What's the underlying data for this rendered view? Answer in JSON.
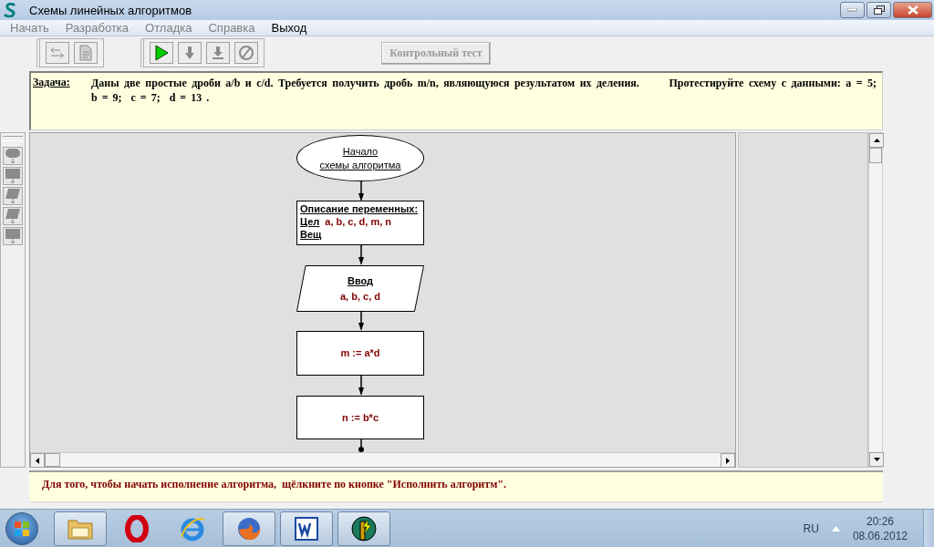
{
  "window": {
    "title": "Схемы линейных алгоритмов"
  },
  "menu": [
    {
      "label": "Начать",
      "disabled": true
    },
    {
      "label": "Разработка",
      "disabled": true
    },
    {
      "label": "Отладка",
      "disabled": true
    },
    {
      "label": "Справка",
      "disabled": true
    },
    {
      "label": "Выход",
      "disabled": false
    }
  ],
  "toolbar": [
    [
      {
        "kind": "arrange",
        "disabled": true
      },
      {
        "kind": "document",
        "disabled": true
      }
    ],
    [
      {
        "kind": "run",
        "disabled": false
      },
      {
        "kind": "step",
        "disabled": true
      },
      {
        "kind": "step-down",
        "disabled": true
      },
      {
        "kind": "stop",
        "disabled": true
      }
    ]
  ],
  "test_button": {
    "label": "Контрольный тест",
    "disabled": true
  },
  "task": {
    "label": "Задача:",
    "text": "Даны две простые дроби a/b и c/d. Требуется получить дробь m/n, являющуюся результатом их деления.      Протестируйте схему с данными: a = 5;  b = 9;  c = 7;  d = 13 ."
  },
  "palette": [
    {
      "kind": "terminal",
      "disabled": true
    },
    {
      "kind": "process",
      "disabled": true
    },
    {
      "kind": "io",
      "disabled": true
    },
    {
      "kind": "io",
      "disabled": true
    },
    {
      "kind": "process",
      "disabled": true
    }
  ],
  "flowchart": {
    "nodes": [
      {
        "kind": "terminal",
        "lines": [
          "Начало",
          "схемы алгоритма"
        ]
      },
      {
        "kind": "declare",
        "title": "Описание переменных:",
        "rows": [
          {
            "type": "Цел",
            "vars": "a, b, c, d, m, n"
          },
          {
            "type": "Вещ",
            "vars": ""
          }
        ]
      },
      {
        "kind": "io",
        "title": "Ввод",
        "text": "a, b, c, d"
      },
      {
        "kind": "process",
        "text": "m := a*d"
      },
      {
        "kind": "process",
        "text": "n := b*c"
      }
    ]
  },
  "hint": "Для того, чтобы начать исполнение алгоритма,  щёлкните по кнопке \"Исполнить алгоритм\".",
  "taskbar": {
    "apps": [
      {
        "kind": "folder",
        "open": true
      },
      {
        "kind": "opera",
        "open": false
      },
      {
        "kind": "ie",
        "open": false
      },
      {
        "kind": "firefox",
        "open": true
      },
      {
        "kind": "word",
        "open": true
      },
      {
        "kind": "app",
        "open": true
      }
    ],
    "language": "RU",
    "time": "20:26",
    "date": "08.06.2012"
  }
}
